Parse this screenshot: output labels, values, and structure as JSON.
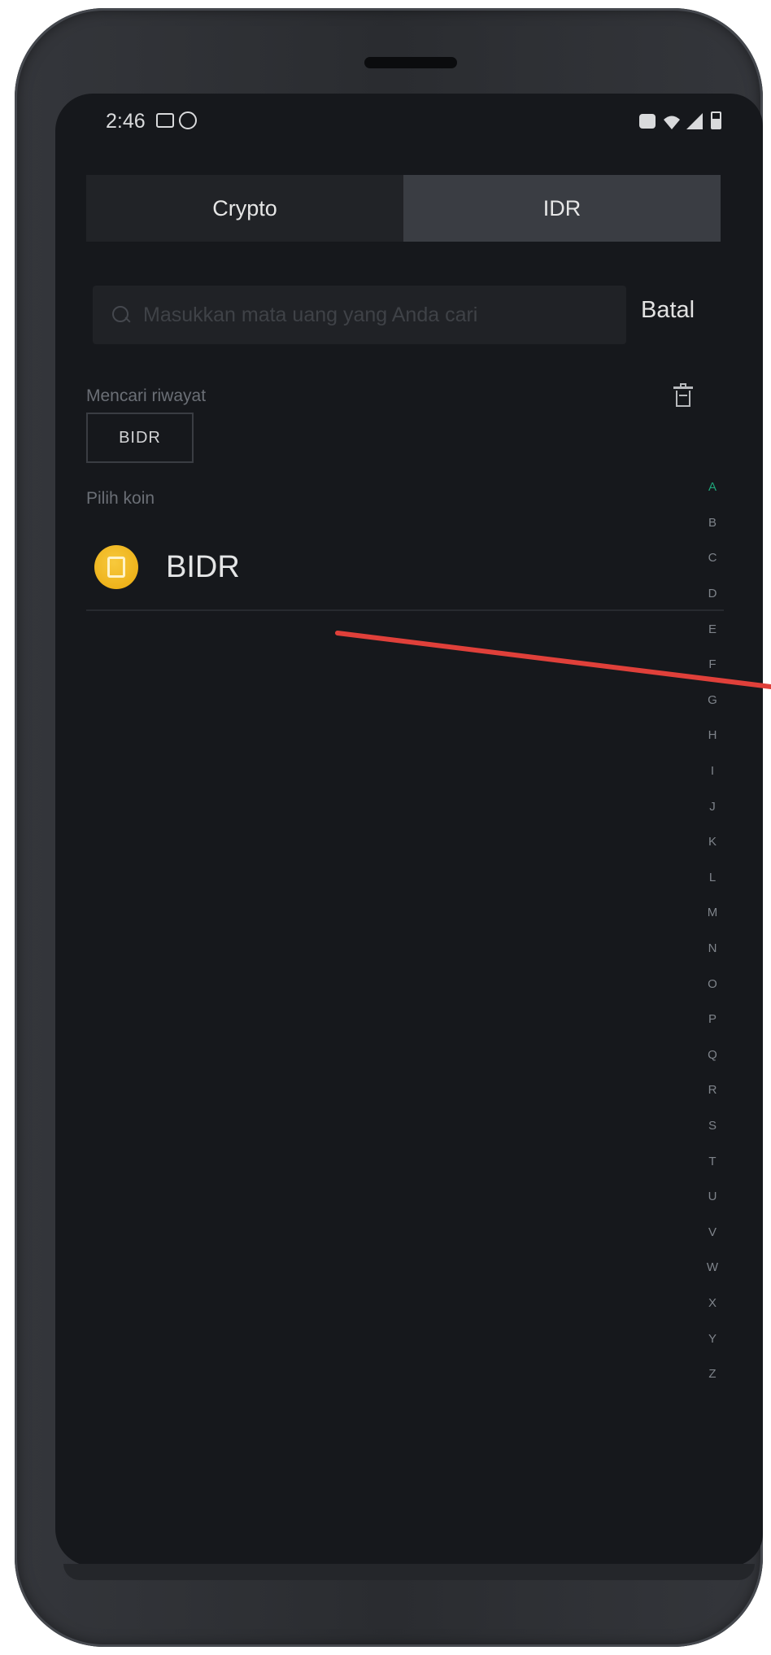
{
  "status_bar": {
    "time": "2:46",
    "left_icons": [
      "image-icon",
      "whatsapp-icon"
    ],
    "right_icons": [
      "alarm-icon",
      "wifi-icon",
      "signal-icon",
      "battery-icon"
    ]
  },
  "tabs": [
    {
      "label": "Crypto",
      "active": false
    },
    {
      "label": "IDR",
      "active": true
    }
  ],
  "search": {
    "placeholder": "Masukkan mata uang yang Anda cari",
    "value": "",
    "cancel_label": "Batal"
  },
  "history": {
    "label": "Mencari riwayat",
    "items": [
      "BIDR"
    ]
  },
  "coins": {
    "label": "Pilih koin",
    "items": [
      {
        "name": "BIDR",
        "icon": "bidr-coin-icon",
        "icon_color": "#F0B90B"
      }
    ]
  },
  "alphabet": [
    "A",
    "B",
    "C",
    "D",
    "E",
    "F",
    "G",
    "H",
    "I",
    "J",
    "K",
    "L",
    "M",
    "N",
    "O",
    "P",
    "Q",
    "R",
    "S",
    "T",
    "U",
    "V",
    "W",
    "X",
    "Y",
    "Z"
  ],
  "colors": {
    "background": "#16181C",
    "tab_active": "#3A3D43",
    "accent_letter": "#1FA57A",
    "annotation_arrow": "#E0403A"
  }
}
